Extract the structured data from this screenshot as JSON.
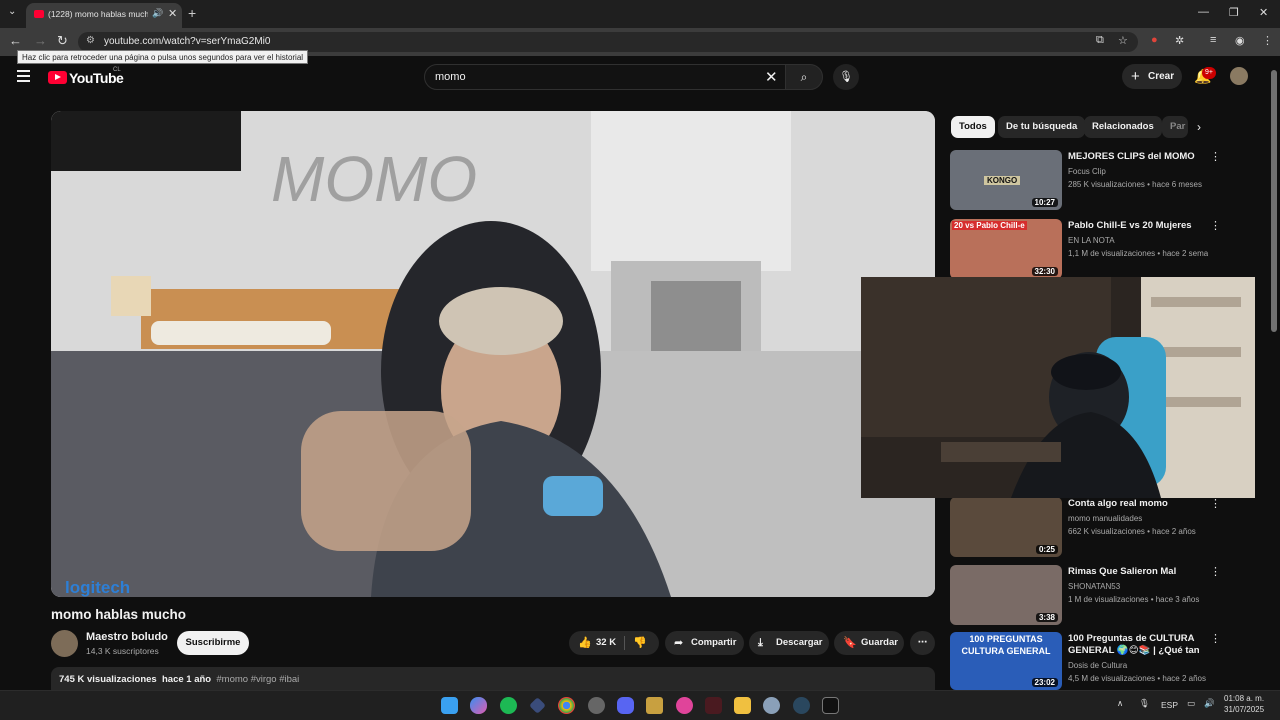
{
  "browser": {
    "tab_title": "(1228) momo hablas mucho",
    "url": "youtube.com/watch?v=serYmaG2Mi0",
    "back_tooltip": "Haz clic para retroceder una página o pulsa unos segundos para ver el historial"
  },
  "header": {
    "logo_text": "YouTube",
    "country_code": "CL",
    "search_value": "momo",
    "create_label": "Crear",
    "notifications_badge": "9+"
  },
  "video": {
    "title": "momo hablas mucho",
    "channel_name": "Maestro boludo",
    "subscribers": "14,3 K suscriptores",
    "subscribe_label": "Suscribirme",
    "likes": "32 K",
    "share_label": "Compartir",
    "download_label": "Descargar",
    "save_label": "Guardar",
    "views": "745 K visualizaciones",
    "age": "hace 1 año",
    "tags": "#momo #virgo #ibai",
    "watermark": "logitech",
    "wall_text": "MOMO"
  },
  "chips": [
    "Todos",
    "De tu búsqueda",
    "Relacionados",
    "Par"
  ],
  "recommendations": [
    {
      "title": "MEJORES CLIPS del MOMO",
      "channel": "Focus Clip",
      "meta": "285 K visualizaciones • hace 6 meses",
      "duration": "10:27",
      "thumb_text": "KONGO",
      "color": "#6a6f78"
    },
    {
      "title": "Pablo Chill-E vs 20 Mujeres",
      "channel": "EN LA NOTA",
      "meta": "1,1 M de visualizaciones • hace 2 seman...",
      "duration": "32:30",
      "thumb_text": "20 vs Pablo Chill-e",
      "color": "#b9705a"
    },
    {
      "title": "Conta algo real momo",
      "channel": "momo manualidades",
      "meta": "662 K visualizaciones • hace 2 años",
      "duration": "0:25",
      "thumb_text": "",
      "color": "#5a4a3c"
    },
    {
      "title": "Rimas Que Salieron Mal",
      "channel": "SHONATAN53",
      "meta": "1 M de visualizaciones • hace 3 años",
      "duration": "3:38",
      "thumb_text": "",
      "color": "#7a6b66"
    },
    {
      "title": "100 Preguntas de CULTURA GENERAL 🌍😊📚 | ¿Qué tan ...",
      "channel": "Dosis de Cultura",
      "meta": "4,5 M de visualizaciones • hace 2 años",
      "duration": "23:02",
      "thumb_text": "100 PREGUNTAS CULTURA GENERAL",
      "color": "#2a5db8"
    }
  ],
  "taskbar": {
    "language": "ESP",
    "time": "01:08 a. m.",
    "date": "31/07/2025"
  }
}
